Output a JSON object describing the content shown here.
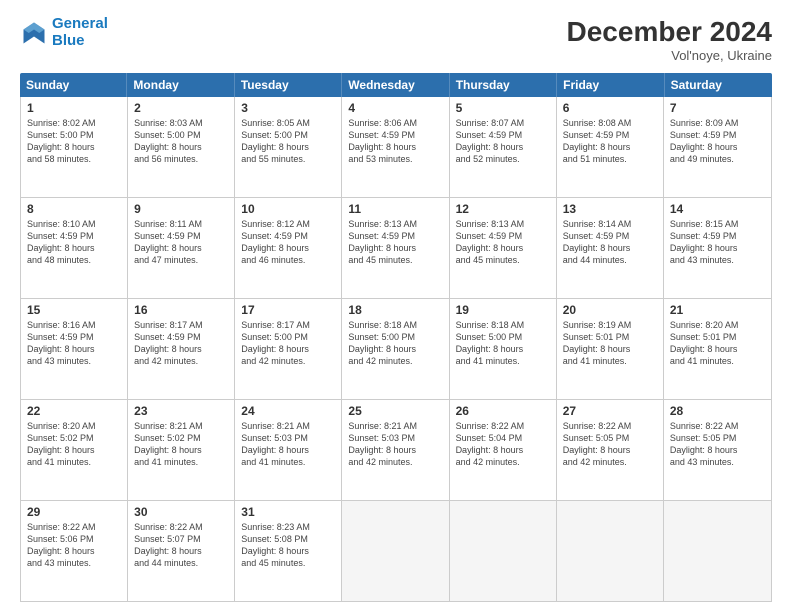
{
  "logo": {
    "line1": "General",
    "line2": "Blue"
  },
  "header": {
    "month": "December 2024",
    "location": "Vol'noye, Ukraine"
  },
  "weekdays": [
    "Sunday",
    "Monday",
    "Tuesday",
    "Wednesday",
    "Thursday",
    "Friday",
    "Saturday"
  ],
  "rows": [
    [
      {
        "day": "1",
        "lines": [
          "Sunrise: 8:02 AM",
          "Sunset: 5:00 PM",
          "Daylight: 8 hours",
          "and 58 minutes."
        ]
      },
      {
        "day": "2",
        "lines": [
          "Sunrise: 8:03 AM",
          "Sunset: 5:00 PM",
          "Daylight: 8 hours",
          "and 56 minutes."
        ]
      },
      {
        "day": "3",
        "lines": [
          "Sunrise: 8:05 AM",
          "Sunset: 5:00 PM",
          "Daylight: 8 hours",
          "and 55 minutes."
        ]
      },
      {
        "day": "4",
        "lines": [
          "Sunrise: 8:06 AM",
          "Sunset: 4:59 PM",
          "Daylight: 8 hours",
          "and 53 minutes."
        ]
      },
      {
        "day": "5",
        "lines": [
          "Sunrise: 8:07 AM",
          "Sunset: 4:59 PM",
          "Daylight: 8 hours",
          "and 52 minutes."
        ]
      },
      {
        "day": "6",
        "lines": [
          "Sunrise: 8:08 AM",
          "Sunset: 4:59 PM",
          "Daylight: 8 hours",
          "and 51 minutes."
        ]
      },
      {
        "day": "7",
        "lines": [
          "Sunrise: 8:09 AM",
          "Sunset: 4:59 PM",
          "Daylight: 8 hours",
          "and 49 minutes."
        ]
      }
    ],
    [
      {
        "day": "8",
        "lines": [
          "Sunrise: 8:10 AM",
          "Sunset: 4:59 PM",
          "Daylight: 8 hours",
          "and 48 minutes."
        ]
      },
      {
        "day": "9",
        "lines": [
          "Sunrise: 8:11 AM",
          "Sunset: 4:59 PM",
          "Daylight: 8 hours",
          "and 47 minutes."
        ]
      },
      {
        "day": "10",
        "lines": [
          "Sunrise: 8:12 AM",
          "Sunset: 4:59 PM",
          "Daylight: 8 hours",
          "and 46 minutes."
        ]
      },
      {
        "day": "11",
        "lines": [
          "Sunrise: 8:13 AM",
          "Sunset: 4:59 PM",
          "Daylight: 8 hours",
          "and 45 minutes."
        ]
      },
      {
        "day": "12",
        "lines": [
          "Sunrise: 8:13 AM",
          "Sunset: 4:59 PM",
          "Daylight: 8 hours",
          "and 45 minutes."
        ]
      },
      {
        "day": "13",
        "lines": [
          "Sunrise: 8:14 AM",
          "Sunset: 4:59 PM",
          "Daylight: 8 hours",
          "and 44 minutes."
        ]
      },
      {
        "day": "14",
        "lines": [
          "Sunrise: 8:15 AM",
          "Sunset: 4:59 PM",
          "Daylight: 8 hours",
          "and 43 minutes."
        ]
      }
    ],
    [
      {
        "day": "15",
        "lines": [
          "Sunrise: 8:16 AM",
          "Sunset: 4:59 PM",
          "Daylight: 8 hours",
          "and 43 minutes."
        ]
      },
      {
        "day": "16",
        "lines": [
          "Sunrise: 8:17 AM",
          "Sunset: 4:59 PM",
          "Daylight: 8 hours",
          "and 42 minutes."
        ]
      },
      {
        "day": "17",
        "lines": [
          "Sunrise: 8:17 AM",
          "Sunset: 5:00 PM",
          "Daylight: 8 hours",
          "and 42 minutes."
        ]
      },
      {
        "day": "18",
        "lines": [
          "Sunrise: 8:18 AM",
          "Sunset: 5:00 PM",
          "Daylight: 8 hours",
          "and 42 minutes."
        ]
      },
      {
        "day": "19",
        "lines": [
          "Sunrise: 8:18 AM",
          "Sunset: 5:00 PM",
          "Daylight: 8 hours",
          "and 41 minutes."
        ]
      },
      {
        "day": "20",
        "lines": [
          "Sunrise: 8:19 AM",
          "Sunset: 5:01 PM",
          "Daylight: 8 hours",
          "and 41 minutes."
        ]
      },
      {
        "day": "21",
        "lines": [
          "Sunrise: 8:20 AM",
          "Sunset: 5:01 PM",
          "Daylight: 8 hours",
          "and 41 minutes."
        ]
      }
    ],
    [
      {
        "day": "22",
        "lines": [
          "Sunrise: 8:20 AM",
          "Sunset: 5:02 PM",
          "Daylight: 8 hours",
          "and 41 minutes."
        ]
      },
      {
        "day": "23",
        "lines": [
          "Sunrise: 8:21 AM",
          "Sunset: 5:02 PM",
          "Daylight: 8 hours",
          "and 41 minutes."
        ]
      },
      {
        "day": "24",
        "lines": [
          "Sunrise: 8:21 AM",
          "Sunset: 5:03 PM",
          "Daylight: 8 hours",
          "and 41 minutes."
        ]
      },
      {
        "day": "25",
        "lines": [
          "Sunrise: 8:21 AM",
          "Sunset: 5:03 PM",
          "Daylight: 8 hours",
          "and 42 minutes."
        ]
      },
      {
        "day": "26",
        "lines": [
          "Sunrise: 8:22 AM",
          "Sunset: 5:04 PM",
          "Daylight: 8 hours",
          "and 42 minutes."
        ]
      },
      {
        "day": "27",
        "lines": [
          "Sunrise: 8:22 AM",
          "Sunset: 5:05 PM",
          "Daylight: 8 hours",
          "and 42 minutes."
        ]
      },
      {
        "day": "28",
        "lines": [
          "Sunrise: 8:22 AM",
          "Sunset: 5:05 PM",
          "Daylight: 8 hours",
          "and 43 minutes."
        ]
      }
    ],
    [
      {
        "day": "29",
        "lines": [
          "Sunrise: 8:22 AM",
          "Sunset: 5:06 PM",
          "Daylight: 8 hours",
          "and 43 minutes."
        ]
      },
      {
        "day": "30",
        "lines": [
          "Sunrise: 8:22 AM",
          "Sunset: 5:07 PM",
          "Daylight: 8 hours",
          "and 44 minutes."
        ]
      },
      {
        "day": "31",
        "lines": [
          "Sunrise: 8:23 AM",
          "Sunset: 5:08 PM",
          "Daylight: 8 hours",
          "and 45 minutes."
        ]
      },
      null,
      null,
      null,
      null
    ]
  ]
}
